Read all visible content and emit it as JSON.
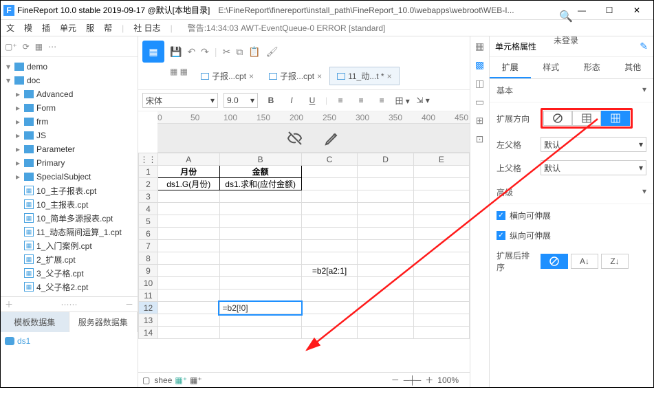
{
  "title": {
    "app": "FineReport 10.0 stable 2019-09-17 @默认[本地目录]",
    "path": "E:\\FineReport\\finereport\\install_path\\FineReport_10.0\\webapps\\webroot\\WEB-I...",
    "min": "—",
    "max": "☐",
    "close": "✕"
  },
  "menu": {
    "items": [
      "文",
      "模",
      "插",
      "单元",
      "服",
      "帮"
    ],
    "logbtn": "社 日志",
    "logline": "警告:14:34:03 AWT-EventQueue-0 ERROR [standard]",
    "login": "未登录"
  },
  "left": {
    "tree": [
      {
        "type": "fold",
        "depth": 0,
        "tw": "▾",
        "label": "demo"
      },
      {
        "type": "fold",
        "depth": 0,
        "tw": "▾",
        "label": "doc"
      },
      {
        "type": "fold",
        "depth": 1,
        "tw": "▸",
        "label": "Advanced"
      },
      {
        "type": "fold",
        "depth": 1,
        "tw": "▸",
        "label": "Form"
      },
      {
        "type": "fold",
        "depth": 1,
        "tw": "▸",
        "label": "frm"
      },
      {
        "type": "fold",
        "depth": 1,
        "tw": "▸",
        "label": "JS"
      },
      {
        "type": "fold",
        "depth": 1,
        "tw": "▸",
        "label": "Parameter"
      },
      {
        "type": "fold",
        "depth": 1,
        "tw": "▸",
        "label": "Primary"
      },
      {
        "type": "fold",
        "depth": 1,
        "tw": "▸",
        "label": "SpecialSubject"
      },
      {
        "type": "file",
        "depth": 1,
        "tw": "",
        "label": "10_主子报表.cpt"
      },
      {
        "type": "file",
        "depth": 1,
        "tw": "",
        "label": "10_主报表.cpt"
      },
      {
        "type": "file",
        "depth": 1,
        "tw": "",
        "label": "10_简单多源报表.cpt"
      },
      {
        "type": "file",
        "depth": 1,
        "tw": "",
        "label": "11_动态隔间运算_1.cpt"
      },
      {
        "type": "file",
        "depth": 1,
        "tw": "",
        "label": "1_入门案例.cpt"
      },
      {
        "type": "file",
        "depth": 1,
        "tw": "",
        "label": "2_扩展.cpt"
      },
      {
        "type": "file",
        "depth": 1,
        "tw": "",
        "label": "3_父子格.cpt"
      },
      {
        "type": "file",
        "depth": 1,
        "tw": "",
        "label": "4_父子格2.cpt"
      }
    ],
    "dsTabs": {
      "template": "模板数据集",
      "server": "服务器数据集"
    },
    "ds": "ds1"
  },
  "tabs": [
    {
      "label": "子报...cpt",
      "close": "×"
    },
    {
      "label": "子报...cpt",
      "close": "×"
    },
    {
      "label": "11_动...t *",
      "close": "×",
      "active": true
    }
  ],
  "format": {
    "font": "宋体",
    "size": "9.0",
    "B": "B",
    "I": "I",
    "U": "U"
  },
  "ruler": {
    "m": [
      "0",
      "50",
      "100",
      "150",
      "200",
      "250",
      "300",
      "350",
      "400",
      "450"
    ]
  },
  "sheet": {
    "cols": [
      "A",
      "B",
      "C",
      "D",
      "E"
    ],
    "rows": 14,
    "cells": {
      "A1": "月份",
      "B1": "金额",
      "A2": "ds1.G(月份)",
      "B2": "ds1.求和(应付金额)",
      "C9": "=b2[a2:1]",
      "B12": "=b2[!0]"
    },
    "selRow": 12,
    "tab": "shee",
    "zoom": "100%"
  },
  "props": {
    "title": "单元格属性",
    "tabs": {
      "t1": "扩展",
      "t2": "样式",
      "t3": "形态",
      "t4": "其他"
    },
    "sec1": "基本",
    "dir": "扩展方向",
    "lparent": "左父格",
    "uparent": "上父格",
    "def": "默认",
    "sec2": "高级",
    "chk1": "横向可伸展",
    "chk2": "纵向可伸展",
    "sort": "扩展后排序"
  }
}
